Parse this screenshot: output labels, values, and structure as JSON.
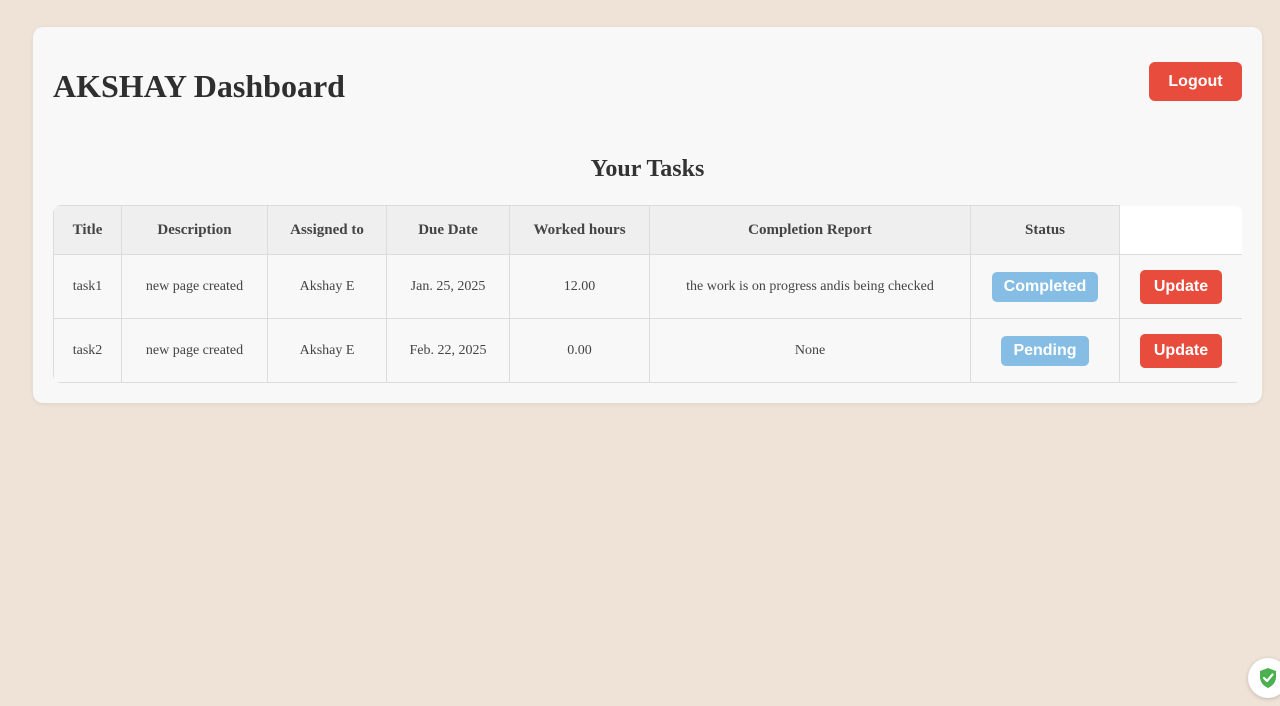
{
  "header": {
    "title": "AKSHAY Dashboard",
    "logout_label": "Logout"
  },
  "tasks_section": {
    "title": "Your Tasks",
    "columns": [
      "Title",
      "Description",
      "Assigned to",
      "Due Date",
      "Worked hours",
      "Completion Report",
      "Status"
    ],
    "rows": [
      {
        "title": "task1",
        "description": "new page created",
        "assigned_to": "Akshay E",
        "due_date": "Jan. 25, 2025",
        "worked_hours": "12.00",
        "completion_report": "the work is on progress andis being checked",
        "status": "Completed",
        "action_label": "Update"
      },
      {
        "title": "task2",
        "description": "new page created",
        "assigned_to": "Akshay E",
        "due_date": "Feb. 22, 2025",
        "worked_hours": "0.00",
        "completion_report": "None",
        "status": "Pending",
        "action_label": "Update"
      }
    ]
  },
  "colors": {
    "background": "#efe3d7",
    "card": "#f8f8f8",
    "accent_red": "#e74c3c",
    "status_blue": "#85bde4",
    "shield_green": "#4caf50"
  },
  "icons": {
    "corner_badge": "shield-check-icon"
  }
}
